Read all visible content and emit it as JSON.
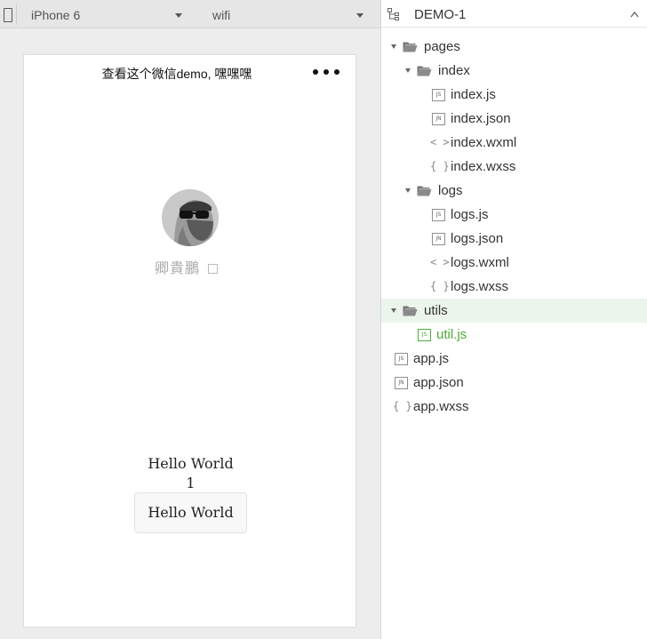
{
  "toolbar": {
    "device": "iPhone 6",
    "network": "wifi"
  },
  "phone": {
    "nav_title": "查看这个微信demo, 嘿嘿嘿",
    "nickname": "卿貴鵬",
    "hello_text": "Hello World",
    "counter": "1",
    "button_label": "Hello World"
  },
  "tree": {
    "project": "DEMO-1",
    "items": [
      {
        "label": "pages",
        "kind": "folder"
      },
      {
        "label": "index",
        "kind": "folder"
      },
      {
        "label": "index.js",
        "kind": "js",
        "badge": "JS"
      },
      {
        "label": "index.json",
        "kind": "json",
        "badge": "JN"
      },
      {
        "label": "index.wxml",
        "kind": "wxml",
        "badge": "< >"
      },
      {
        "label": "index.wxss",
        "kind": "wxss",
        "badge": "{ }"
      },
      {
        "label": "logs",
        "kind": "folder"
      },
      {
        "label": "logs.js",
        "kind": "js",
        "badge": "JS"
      },
      {
        "label": "logs.json",
        "kind": "json",
        "badge": "JN"
      },
      {
        "label": "logs.wxml",
        "kind": "wxml",
        "badge": "< >"
      },
      {
        "label": "logs.wxss",
        "kind": "wxss",
        "badge": "{ }"
      },
      {
        "label": "utils",
        "kind": "folder",
        "selected": true
      },
      {
        "label": "util.js",
        "kind": "js",
        "badge": "JS",
        "active": true
      },
      {
        "label": "app.js",
        "kind": "js",
        "badge": "JS"
      },
      {
        "label": "app.json",
        "kind": "json",
        "badge": "JN"
      },
      {
        "label": "app.wxss",
        "kind": "wxss",
        "badge": "{ }"
      }
    ]
  },
  "colors": {
    "active_file": "#4cab38",
    "selected_row": "#ecf5ec"
  }
}
